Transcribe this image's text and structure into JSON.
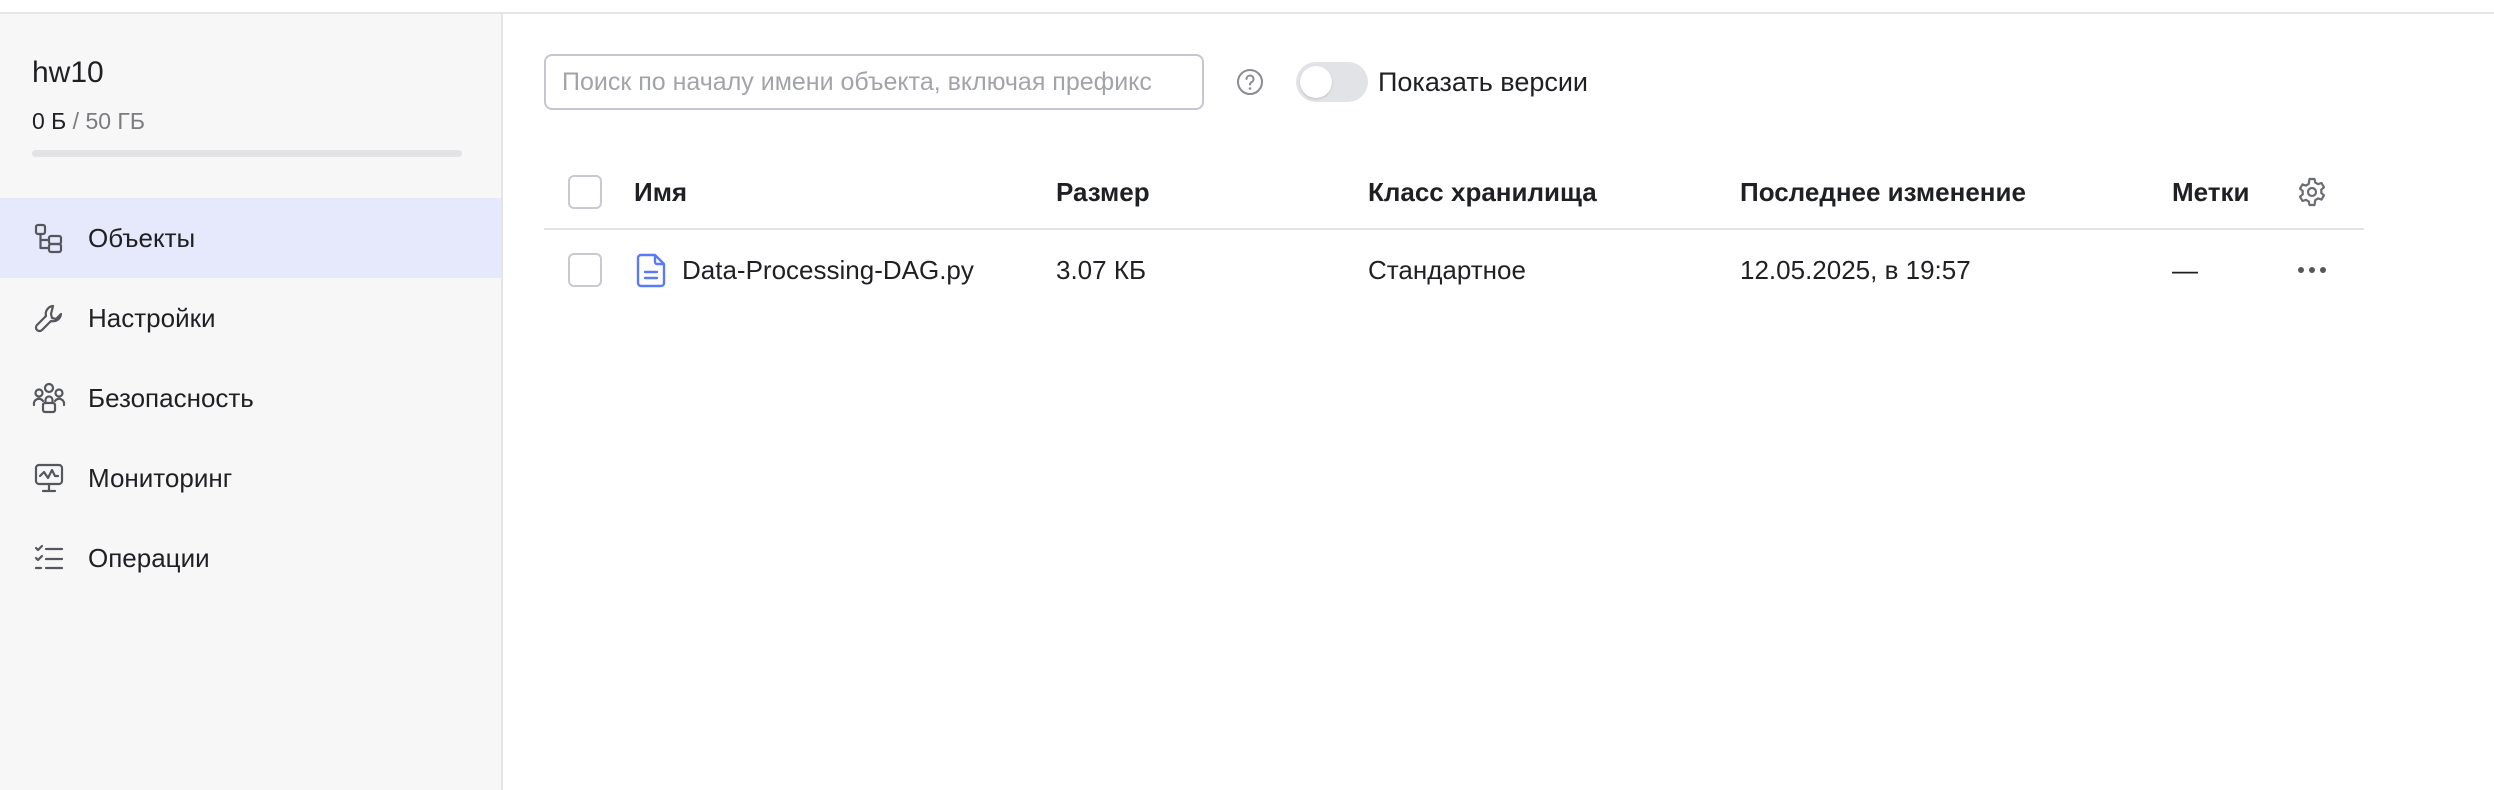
{
  "sidebar": {
    "bucket_name": "hw10",
    "usage": {
      "used": "0 Б",
      "separator": "/",
      "total": "50 ГБ",
      "fill_fraction": 0.0
    },
    "items": [
      {
        "label": "Объекты",
        "icon": "objects-tree-icon",
        "active": true
      },
      {
        "label": "Настройки",
        "icon": "wrench-icon",
        "active": false
      },
      {
        "label": "Безопасность",
        "icon": "persons-lock-icon",
        "active": false
      },
      {
        "label": "Мониторинг",
        "icon": "monitor-chart-icon",
        "active": false
      },
      {
        "label": "Операции",
        "icon": "list-check-icon",
        "active": false
      }
    ]
  },
  "toolbar": {
    "search_placeholder": "Поиск по началу имени объекта, включая префикс",
    "search_value": "",
    "help_icon": "question-circle-icon",
    "show_versions_label": "Показать версии",
    "show_versions_enabled": false
  },
  "table": {
    "columns": {
      "name": "Имя",
      "size": "Размер",
      "storage_class": "Класс хранилища",
      "modified": "Последнее изменение",
      "labels": "Метки"
    },
    "settings_icon": "gear-icon",
    "rows": [
      {
        "name": "Data-Processing-DAG.py",
        "size": "3.07 КБ",
        "storage_class": "Стандартное",
        "modified": "12.05.2025, в 19:57",
        "labels": "—",
        "icon": "file-text-icon",
        "menu_icon": "ellipsis-icon"
      }
    ]
  },
  "colors": {
    "accent": "#4d6cf3",
    "active_nav_bg": "#e5e9fb",
    "sidebar_bg": "#f7f7f8",
    "file_icon": "#5b7bf5"
  }
}
